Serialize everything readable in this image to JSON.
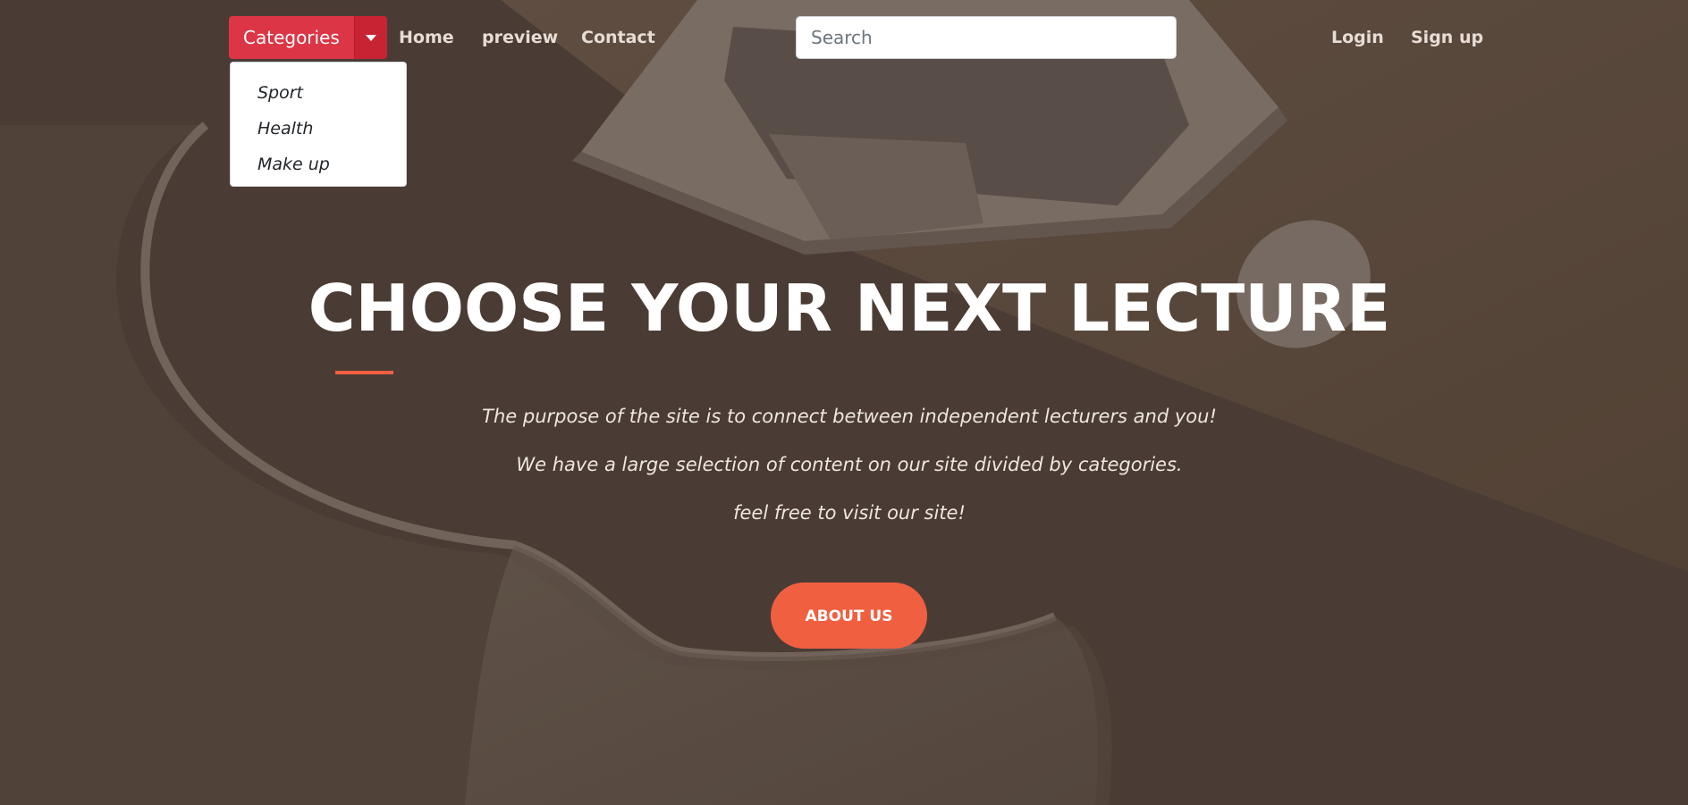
{
  "navbar": {
    "categories_label": "Categories",
    "links": {
      "home": "Home",
      "preview": "preview",
      "contact": "Contact",
      "login": "Login",
      "signup": "Sign up"
    },
    "search": {
      "placeholder": "Search",
      "value": ""
    }
  },
  "categories_menu": {
    "items": [
      "Sport",
      "Health",
      "Make up"
    ]
  },
  "hero": {
    "title": "CHOOSE YOUR NEXT LECTURE",
    "lines": [
      "The purpose of the site is to connect between independent lecturers and you!",
      "We have a large selection of content on our site divided by categories.",
      "feel free to visit our site!"
    ],
    "button_label": "ABOUT US"
  },
  "colors": {
    "accent": "#f05f40",
    "categories_button": "#dc3545",
    "background": "#4c3f37"
  },
  "icons": {
    "dropdown_toggle": "caret-down-icon"
  }
}
